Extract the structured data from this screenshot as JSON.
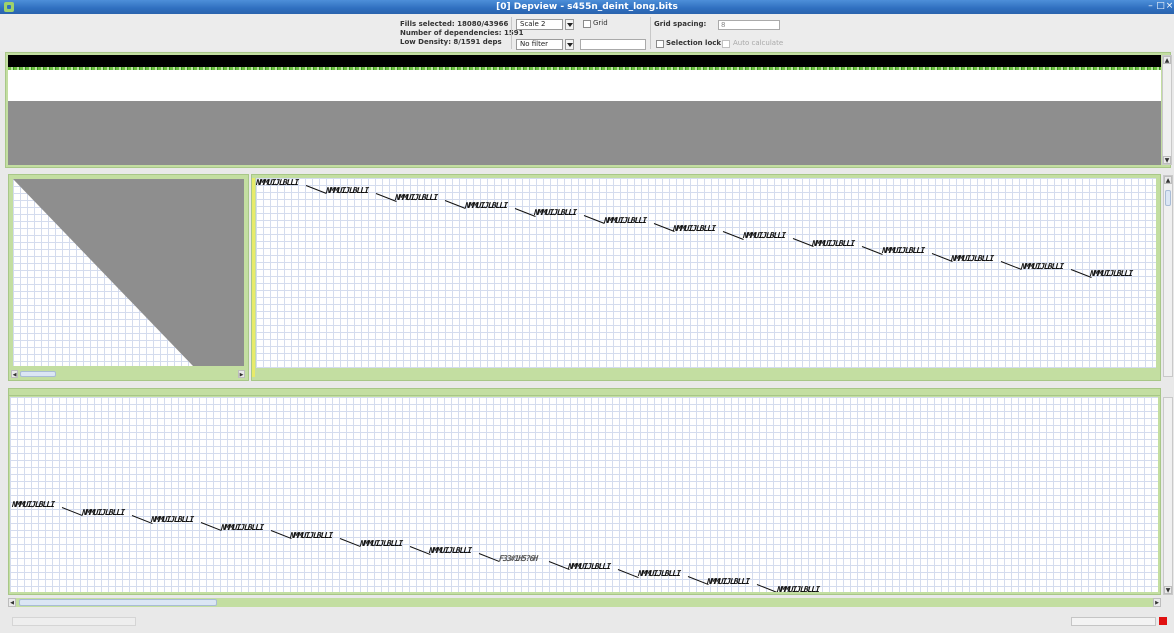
{
  "window": {
    "title": "[0] Depview - s455n_deint_long.bits"
  },
  "toolbar": {
    "stats": {
      "fills_selected": "Fills selected: 18080/43966",
      "dependencies": "Number of dependencies: 1591",
      "low_density": "Low Density: 8/1591 deps"
    },
    "scale_select": {
      "value": "Scale 2"
    },
    "filter_select": {
      "value": "No filter"
    },
    "filter_input": {
      "value": ""
    },
    "grid_checkbox": {
      "label": "Grid",
      "checked": false
    },
    "selection_lock_checkbox": {
      "label": "Selection lock",
      "checked": false
    },
    "auto_calculate_checkbox": {
      "label": "Auto calculate",
      "checked": false,
      "enabled": false
    },
    "grid_spacing": {
      "label": "Grid spacing:",
      "value": "8"
    }
  },
  "colors": {
    "titlebar": "#2f6fbf",
    "panel_frame": "#c3dea1",
    "grid_line": "#d4dcee",
    "overview_gray": "#8e8e8e",
    "status_indicator": "#e01010"
  },
  "dependency_labels": {
    "normal": "NMMUIJLBLLI",
    "faint": "F33#1H5?6H"
  }
}
